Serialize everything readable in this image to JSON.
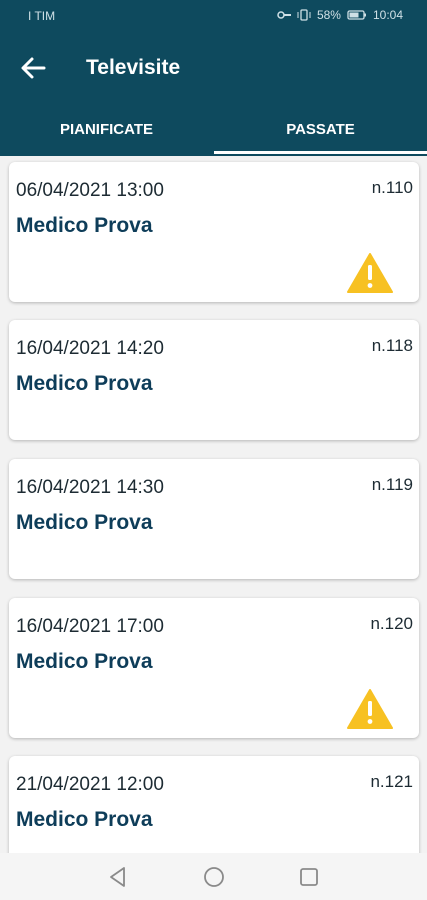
{
  "status_bar": {
    "carrier": "I TIM",
    "battery": "58%",
    "time": "10:04"
  },
  "header": {
    "title": "Televisite"
  },
  "tabs": [
    {
      "label": "PIANIFICATE"
    },
    {
      "label": "PASSATE"
    }
  ],
  "visits": [
    {
      "datetime": "06/04/2021 13:00",
      "number": "n.110",
      "doctor": "Medico Prova",
      "warning": true
    },
    {
      "datetime": "16/04/2021 14:20",
      "number": "n.118",
      "doctor": "Medico Prova",
      "warning": false
    },
    {
      "datetime": "16/04/2021 14:30",
      "number": "n.119",
      "doctor": "Medico Prova",
      "warning": false
    },
    {
      "datetime": "16/04/2021 17:00",
      "number": "n.120",
      "doctor": "Medico Prova",
      "warning": true
    },
    {
      "datetime": "21/04/2021 12:00",
      "number": "n.121",
      "doctor": "Medico Prova",
      "warning": false
    }
  ],
  "colors": {
    "primary": "#0e4a5e",
    "warning": "#f7c122",
    "text_dark": "#0e3d59"
  },
  "icons": {
    "back": "arrow-left-icon",
    "warning": "warning-triangle-icon",
    "nav_back": "triangle-back-icon",
    "nav_home": "circle-home-icon",
    "nav_recent": "square-recent-icon"
  }
}
